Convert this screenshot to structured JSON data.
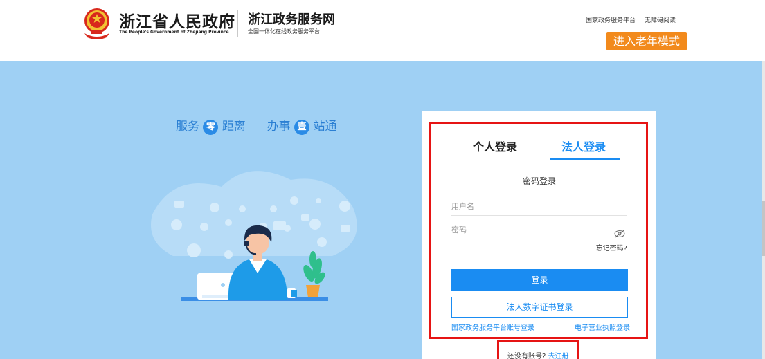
{
  "header": {
    "gov_name": "浙江省人民政府",
    "gov_name_en": "The People's Government of Zhejiang Province",
    "service_name": "浙江政务服务网",
    "service_subtitle": "全国一体化在线政务服务平台",
    "link_national": "国家政务服务平台",
    "link_accessible": "无障碍阅读",
    "elder_mode_label": "进入老年模式"
  },
  "banner": {
    "slogan_part1": "服务",
    "slogan_circle1": "零",
    "slogan_part2": "距离",
    "slogan_part3": "办事",
    "slogan_circle2": "壹",
    "slogan_part4": "站通"
  },
  "login": {
    "tab_personal": "个人登录",
    "tab_corporate": "法人登录",
    "active_tab": "法人登录",
    "method_title": "密码登录",
    "username_placeholder": "用户名",
    "password_placeholder": "密码",
    "forgot_password": "忘记密码?",
    "login_button": "登录",
    "cert_login_button": "法人数字证书登录",
    "national_account_login": "国家政务服务平台账号登录",
    "license_login": "电子营业执照登录",
    "no_account_text": "还没有账号?",
    "register_link": "去注册"
  },
  "colors": {
    "accent": "#1a8cf2",
    "banner_bg": "#9fd0f4",
    "elder_button": "#f28a1c",
    "highlight_border": "#e61414"
  },
  "icons": [
    "national-emblem-icon",
    "eye-toggle-icon"
  ]
}
